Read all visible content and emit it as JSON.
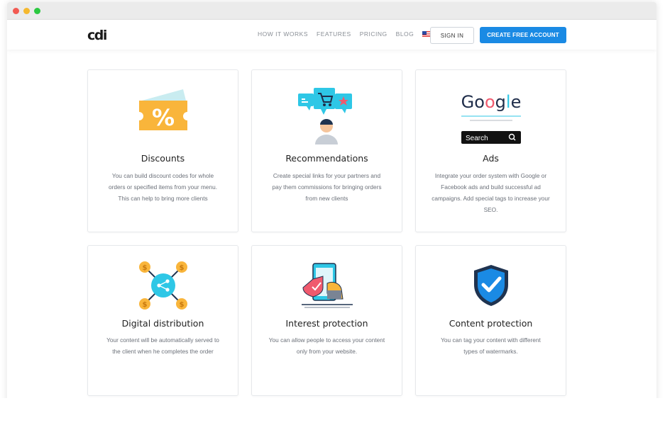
{
  "app": {
    "logo": "cdi"
  },
  "nav": {
    "items": [
      "HOW IT WORKS",
      "FEATURES",
      "PRICING",
      "BLOG"
    ],
    "sign_in": "SIGN IN",
    "create_account": "CREATE FREE ACCOUNT"
  },
  "colors": {
    "accent": "#1a8ae4",
    "window_dots": [
      "#f25a52",
      "#f5b82e",
      "#2bc840"
    ]
  },
  "features": [
    {
      "title": "Discounts",
      "icon": "discount-ticket-icon",
      "lines": [
        "You can build discount codes for whole",
        "orders or specified items from your menu.",
        "This can help to bring more clients"
      ]
    },
    {
      "title": "Recommendations",
      "icon": "recommendation-person-icon",
      "lines": [
        "Create special links for your partners and",
        "pay them commissions for bringing orders",
        "from new clients"
      ]
    },
    {
      "title": "Ads",
      "icon": "google-search-icon",
      "google_text": "Google",
      "search_text": "Search",
      "lines": [
        "Integrate your order system with Google or",
        "Facebook ads and build successful ad",
        "campaigns. Add special tags to increase your",
        "SEO."
      ]
    },
    {
      "title": "Digital distribution",
      "icon": "share-distribution-icon",
      "lines": [
        "Your content will be automatically served to",
        "the client when he completes the order"
      ]
    },
    {
      "title": "Interest protection",
      "icon": "phone-protection-icon",
      "lines": [
        "You can allow people to access your content",
        "only from your website."
      ]
    },
    {
      "title": "Content protection",
      "icon": "shield-check-icon",
      "lines": [
        "You can tag your content with different",
        "types of watermarks."
      ]
    }
  ]
}
